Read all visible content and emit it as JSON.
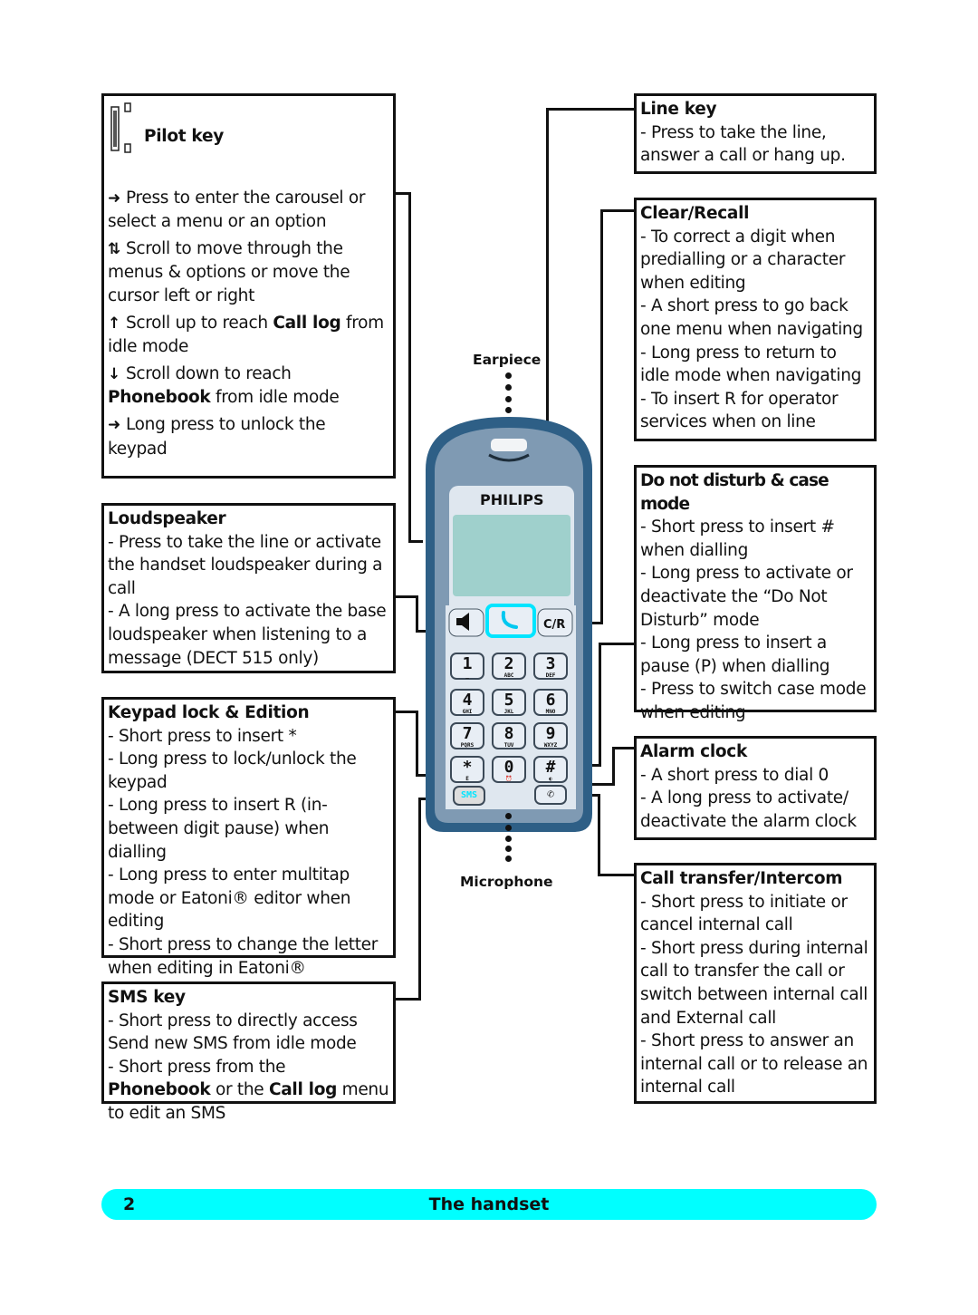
{
  "pilot_key": {
    "title": "Pilot key",
    "items": [
      {
        "icon": "select-icon",
        "glyph": "➜",
        "text": "Press to enter the carousel or select a menu or an option"
      },
      {
        "icon": "scroll-icon",
        "glyph": "⇅",
        "text": "Scroll to move through the menus & options or move the cursor left or right"
      },
      {
        "icon": "scroll-up-icon",
        "glyph": "↑",
        "text_pre": "Scroll up to reach ",
        "bold": "Call log",
        "text_post": " from idle mode"
      },
      {
        "icon": "scroll-down-icon",
        "glyph": "↓",
        "text_pre": "Scroll down to reach ",
        "bold": "Phonebook",
        "text_post": " from idle mode"
      },
      {
        "icon": "unlock-icon",
        "glyph": "➜",
        "text": "Long press to unlock the keypad"
      }
    ]
  },
  "loudspeaker": {
    "title": "Loudspeaker",
    "lines": [
      "- Press to take the line or activate the handset loudspeaker during a call",
      "- A long press to activate the base loudspeaker when listening to a message (DECT 515 only)"
    ]
  },
  "keypad_lock": {
    "title": "Keypad lock & Edition",
    "lines": [
      "- Short press to insert *",
      "- Long press to lock/unlock the keypad",
      "- Long press to insert R (in-between digit pause) when dialling",
      "- Long press to enter multitap mode or Eatoni® editor when editing",
      "- Short press to change the letter when editing in Eatoni®"
    ]
  },
  "sms_key": {
    "title": "SMS key",
    "line1": "- Short press to directly access Send new SMS from idle mode",
    "line2_pre": "- Short press from the ",
    "line2_bold1": "Phonebook",
    "line2_mid": " or the ",
    "line2_bold2": "Call log",
    "line2_post": " menu to edit an SMS"
  },
  "line_key": {
    "title": "Line key",
    "lines": [
      "- Press to take the line, answer a call or hang up."
    ]
  },
  "clear_recall": {
    "title": "Clear/Recall",
    "lines": [
      "- To correct a digit when predialling or a character when editing",
      "- A short press to go back one menu when navigating",
      "- Long press to return to idle mode when navigating",
      "- To insert R for operator services when on line"
    ]
  },
  "do_not_disturb": {
    "title": "Do not disturb & case mode",
    "lines": [
      "- Short press to insert # when dialling",
      "- Long press to activate or deactivate the “Do Not Disturb” mode",
      "- Long press to insert a pause (P) when dialling",
      "- Press to switch case mode when editing"
    ]
  },
  "alarm_clock": {
    "title": "Alarm clock",
    "lines": [
      "- A short press to dial 0",
      "- A long press to activate/ deactivate the alarm clock"
    ]
  },
  "call_transfer": {
    "title": "Call transfer/Intercom",
    "lines": [
      "- Short press to initiate or cancel internal call",
      "- Short press during internal call to transfer the call or switch between internal call and External call",
      "- Short press to answer an internal call or to release an internal call"
    ]
  },
  "labels": {
    "earpiece": "Earpiece",
    "microphone": "Microphone"
  },
  "phone": {
    "brand": "PHILIPS",
    "clear_key": "C/R",
    "sms_key": "SMS",
    "keys": [
      {
        "d": "1",
        "s": "_"
      },
      {
        "d": "2",
        "s": "ABC"
      },
      {
        "d": "3",
        "s": "DEF"
      },
      {
        "d": "4",
        "s": "GHI"
      },
      {
        "d": "5",
        "s": "JKL"
      },
      {
        "d": "6",
        "s": "MNO"
      },
      {
        "d": "7",
        "s": "PQRS"
      },
      {
        "d": "8",
        "s": "TUV"
      },
      {
        "d": "9",
        "s": "WXYZ"
      },
      {
        "d": "*",
        "s": "E"
      },
      {
        "d": "0",
        "s": "⏰"
      },
      {
        "d": "#",
        "s": "◐"
      }
    ],
    "colors": {
      "body": "#2e5f86",
      "face": "#7f9ab3",
      "screen": "#9fd0cc",
      "keys": "#e8eef5",
      "accent": "#00e5ff"
    }
  },
  "footer": {
    "page": "2",
    "title": "The handset",
    "color": "#00ffff"
  }
}
